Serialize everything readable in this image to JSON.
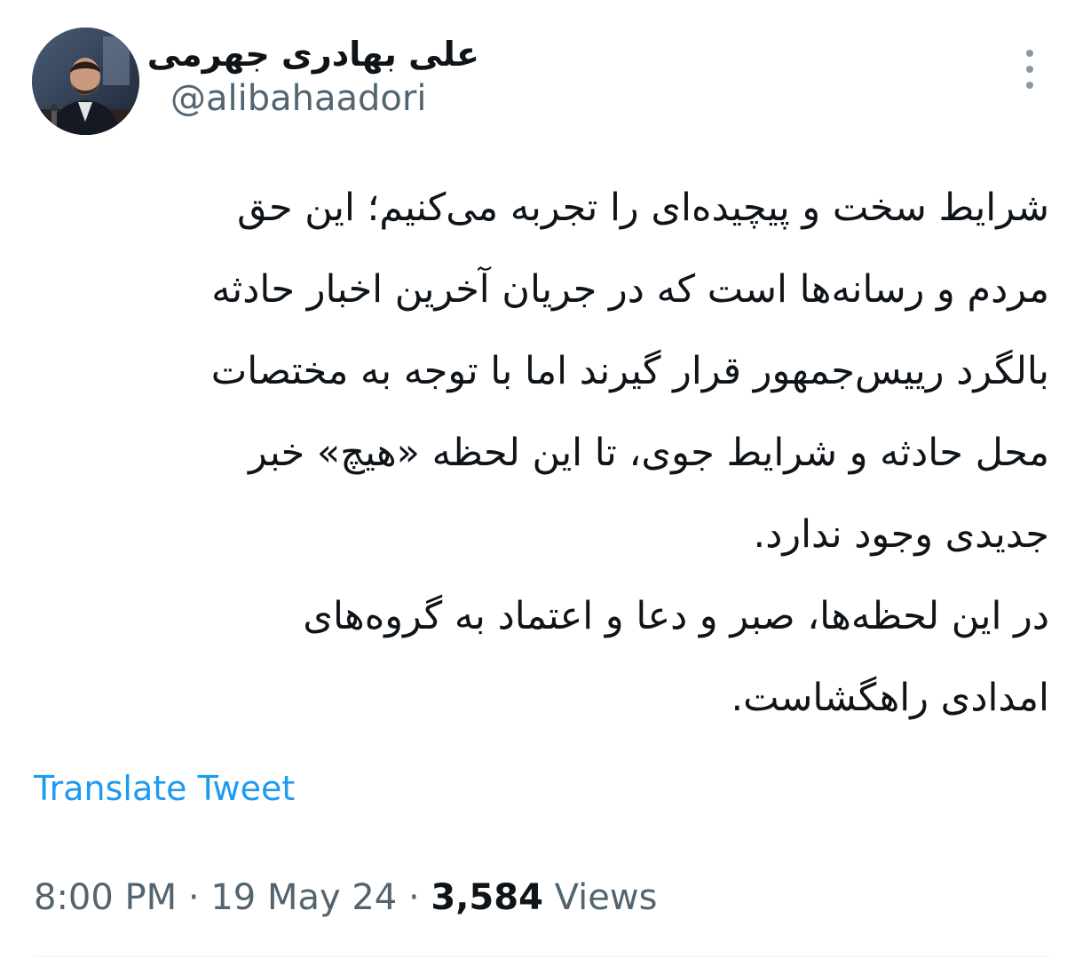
{
  "author": {
    "display_name": "علی بهادری جهرمی",
    "handle": "@alibahaadori",
    "avatar_icon": "profile-photo"
  },
  "tweet": {
    "lines": [
      "شرایط سخت و پیچیده‌ای را تجربه می‌کنیم؛ این حق",
      "مردم و رسانه‌ها است که در جریان آخرین اخبار حادثه",
      "بالگرد رییس‌جمهور قرار گیرند اما با توجه به مختصات",
      "محل حادثه و شرایط جوی، تا این لحظه «هیچ» خبر",
      "جدیدی وجود ندارد.",
      "در این لحظه‌ها، صبر و دعا و اعتماد به گروه‌های",
      "امدادی راهگشاست."
    ]
  },
  "actions": {
    "translate_label": "Translate Tweet",
    "more_icon": "more-options-icon"
  },
  "meta": {
    "time": "8:00 PM",
    "separator": " · ",
    "date": "19 May 24",
    "views_count": "3,584",
    "views_label": "Views"
  },
  "colors": {
    "text": "#0f1419",
    "secondary": "#536471",
    "link": "#1d9bf0"
  }
}
